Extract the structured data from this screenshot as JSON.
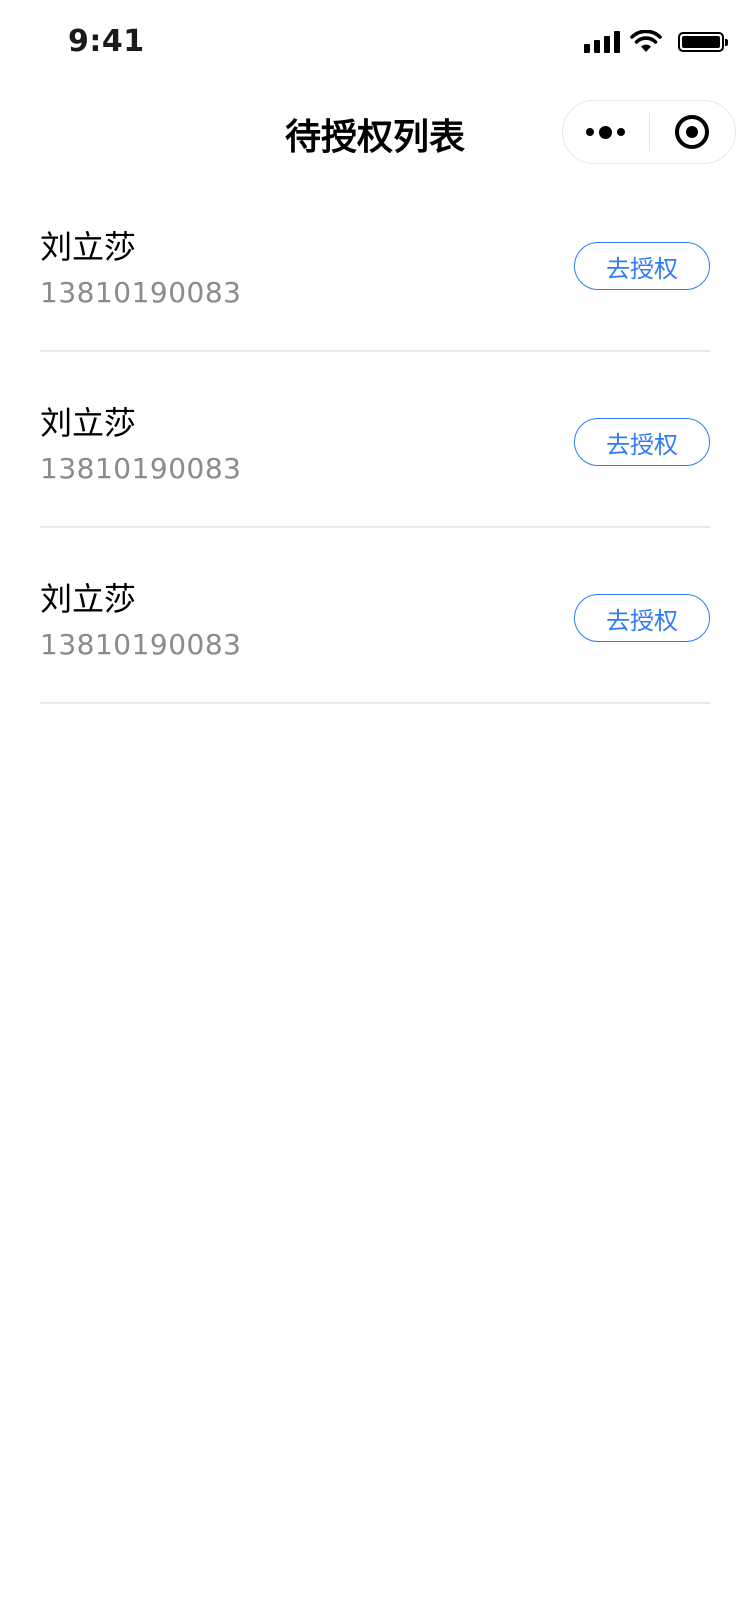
{
  "status_bar": {
    "time": "9:41",
    "icons": [
      "cellular-signal-icon",
      "wifi-icon",
      "battery-icon"
    ]
  },
  "nav": {
    "title": "待授权列表",
    "capsule": {
      "more_icon": "more-dots-icon",
      "close_icon": "close-circle-icon"
    }
  },
  "list": {
    "items": [
      {
        "name": "刘立莎",
        "phone": "13810190083",
        "action_label": "去授权"
      },
      {
        "name": "刘立莎",
        "phone": "13810190083",
        "action_label": "去授权"
      },
      {
        "name": "刘立莎",
        "phone": "13810190083",
        "action_label": "去授权"
      }
    ]
  },
  "colors": {
    "accent": "#2f7cf6",
    "secondary_text": "#8a8a8a",
    "divider": "#e9e9e9"
  }
}
